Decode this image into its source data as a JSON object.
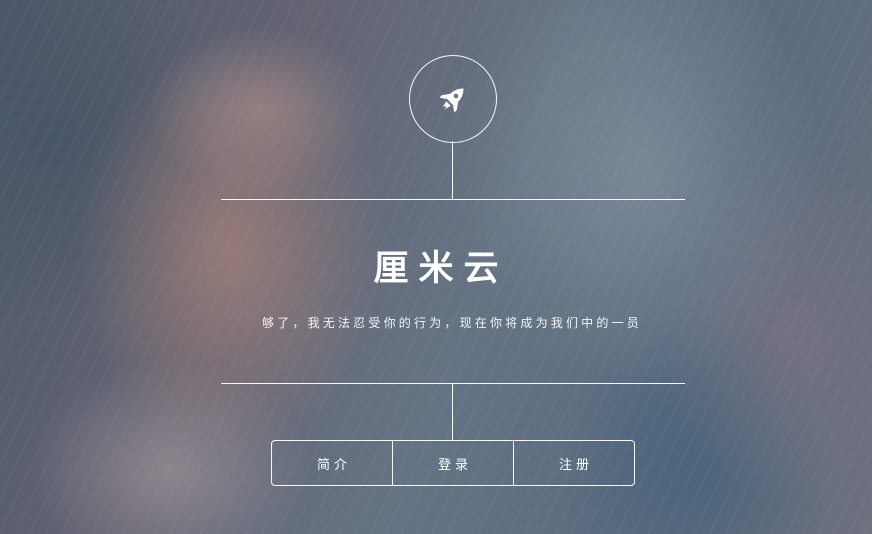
{
  "header": {
    "logo_icon": "rocket-icon",
    "title": "厘米云",
    "subtitle": "够了，我无法忍受你的行为，现在你将成为我们中的一员"
  },
  "nav": {
    "items": [
      {
        "label": "简介"
      },
      {
        "label": "登录"
      },
      {
        "label": "注册"
      }
    ]
  },
  "colors": {
    "foreground": "#ffffff",
    "veil": "#28374b"
  }
}
